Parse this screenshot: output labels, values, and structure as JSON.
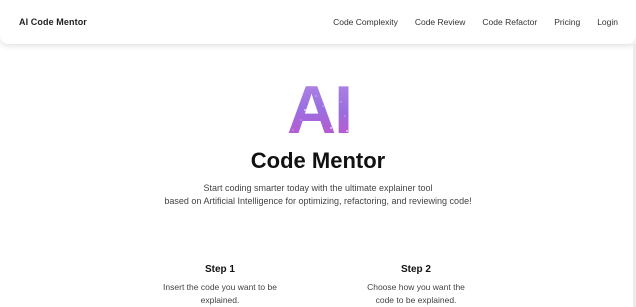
{
  "navbar": {
    "brand": "AI Code Mentor",
    "links": [
      "Code Complexity",
      "Code Review",
      "Code Refactor",
      "Pricing",
      "Login"
    ]
  },
  "hero": {
    "logo_text": "AI",
    "title": "Code Mentor",
    "subtitle_lines": [
      "Start coding smarter today with the ultimate explainer tool",
      "based on Artificial Intelligence for optimizing, refactoring, and reviewing code!"
    ]
  },
  "steps": [
    {
      "title": "Step 1",
      "desc_lines": [
        "Insert the code you want to be",
        "explained."
      ]
    },
    {
      "title": "Step 2",
      "desc_lines": [
        "Choose how you want the",
        "code to be explained."
      ]
    }
  ],
  "colors": {
    "logo_gradient_top": "#b48be6",
    "logo_gradient_mid": "#9a6fe0",
    "logo_gradient_bottom": "#c64fc8",
    "sparkle": "#ffffff"
  }
}
